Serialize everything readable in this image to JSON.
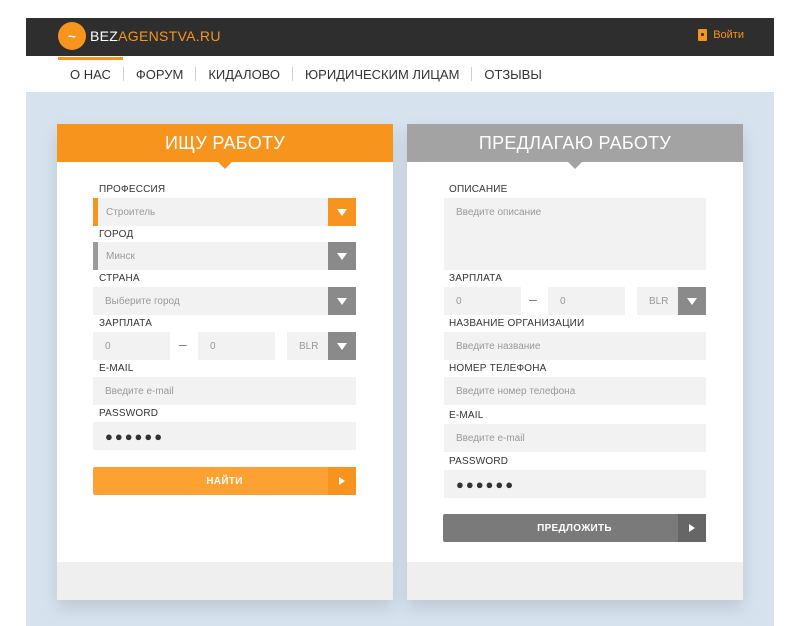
{
  "header": {
    "logo_part1": "BEZ",
    "logo_part2": "AGENSTVA.RU",
    "logo_mark": "~",
    "login_label": "Войти"
  },
  "nav": {
    "items": [
      {
        "label": "О НАС"
      },
      {
        "label": "ФОРУМ"
      },
      {
        "label": "КИДАЛОВО"
      },
      {
        "label": "ЮРИДИЧЕСКИМ ЛИЦАМ"
      },
      {
        "label": "ОТЗЫВЫ"
      }
    ]
  },
  "seek": {
    "title": "ИЩУ РАБОТУ",
    "profession_label": "ПРОФЕССИЯ",
    "profession_value": "Строитель",
    "city_label": "ГОРОД",
    "city_value": "Минск",
    "country_label": "СТРАНА",
    "country_placeholder": "Выберите город",
    "salary_label": "ЗАРПЛАТА",
    "salary_from": "0",
    "salary_dash": "–",
    "salary_to": "0",
    "currency": "BLR",
    "email_label": "E-MAIL",
    "email_placeholder": "Введите e-mail",
    "password_label": "PASSWORD",
    "password_value": "●●●●●●",
    "button_label": "НАЙТИ"
  },
  "offer": {
    "title": "ПРЕДЛАГАЮ РАБОТУ",
    "description_label": "ОПИСАНИЕ",
    "description_placeholder": "Введите описание",
    "salary_label": "ЗАРПЛАТА",
    "salary_from": "0",
    "salary_dash": "–",
    "salary_to": "0",
    "currency": "BLR",
    "org_label": "НАЗВАНИЕ ОРГАНИЗАЦИИ",
    "org_placeholder": "Введите название",
    "phone_label": "НОМЕР ТЕЛЕФОНА",
    "phone_placeholder": "Введите номер телефона",
    "email_label": "E-MAIL",
    "email_placeholder": "Введите e-mail",
    "password_label": "PASSWORD",
    "password_value": "●●●●●●",
    "button_label": "ПРЕДЛОЖИТЬ"
  },
  "colors": {
    "accent": "#f7941d",
    "header_bg": "#2e2e2e",
    "page_bg": "#d6e3ef",
    "gray_panel": "#a3a3a3"
  },
  "icons": [
    "handshake-logo-icon",
    "login-door-icon",
    "chevron-down-icon",
    "play-arrow-icon"
  ]
}
